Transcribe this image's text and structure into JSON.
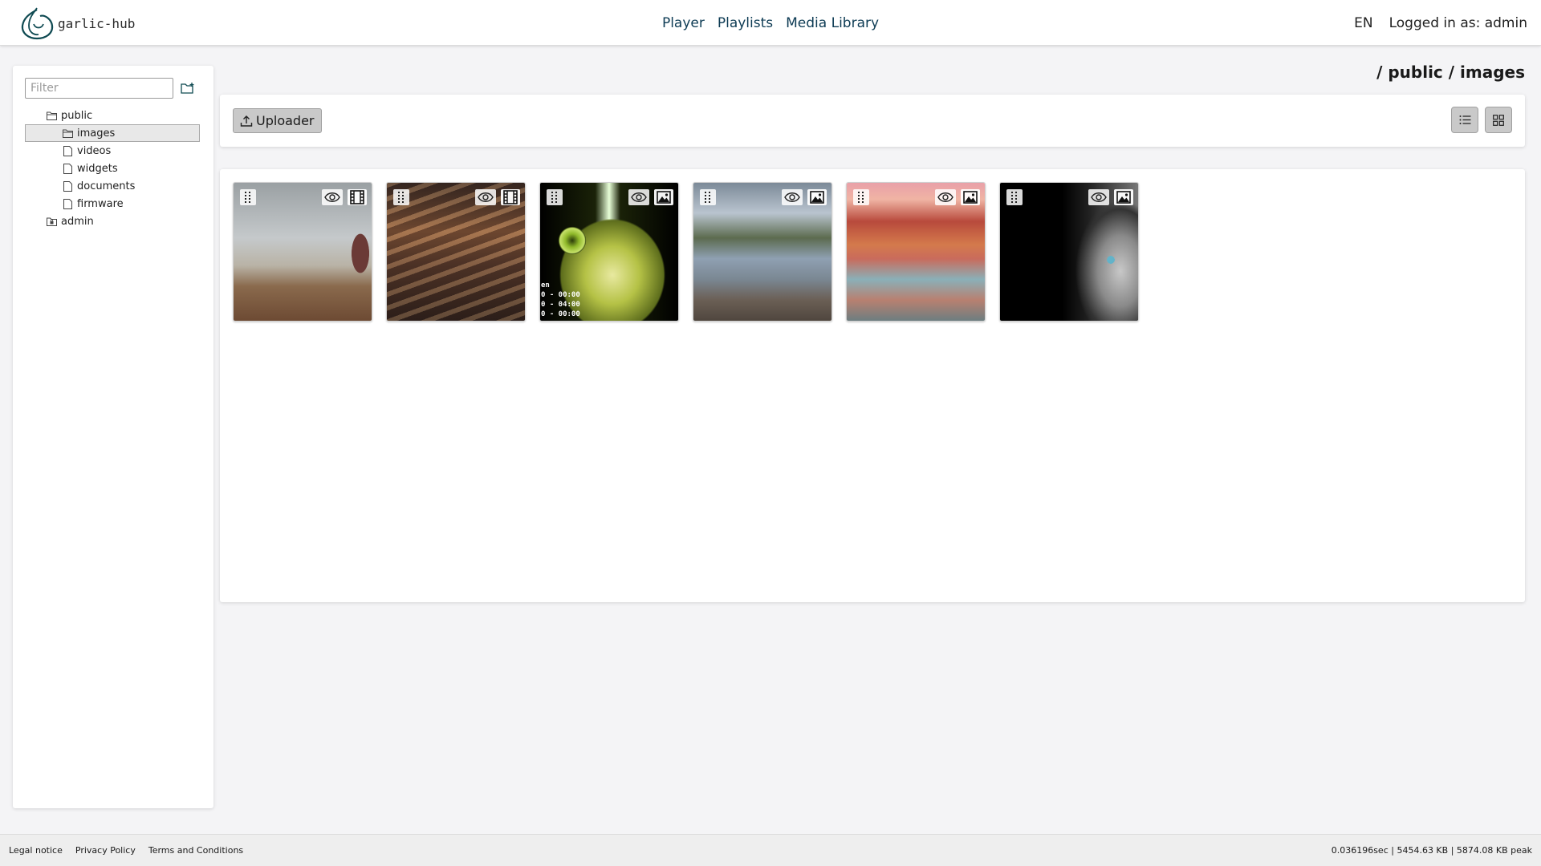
{
  "header": {
    "logo_text": "garlic-hub",
    "nav": [
      "Player",
      "Playlists",
      "Media Library"
    ],
    "language": "EN",
    "login_status": "Logged in as: admin"
  },
  "sidebar": {
    "filter_placeholder": "Filter",
    "tree": [
      {
        "label": "public",
        "icon": "folder-open-icon"
      },
      {
        "label": "images",
        "icon": "folder-open-icon",
        "selected": true
      },
      {
        "label": "videos",
        "icon": "file-icon"
      },
      {
        "label": "widgets",
        "icon": "file-icon"
      },
      {
        "label": "documents",
        "icon": "file-icon"
      },
      {
        "label": "firmware",
        "icon": "file-icon"
      },
      {
        "label": "admin",
        "icon": "folder-lock-icon"
      }
    ]
  },
  "content": {
    "breadcrumb": "/ public / images",
    "uploader_label": "Uploader",
    "media": [
      {
        "type": "video",
        "type_icon": "film-icon"
      },
      {
        "type": "video",
        "type_icon": "film-icon"
      },
      {
        "type": "image",
        "type_icon": "image-icon",
        "overlay_text": [
          "en",
          "0 - 00:00",
          "0 - 04:00",
          "0 - 00:00"
        ]
      },
      {
        "type": "image",
        "type_icon": "image-icon"
      },
      {
        "type": "image",
        "type_icon": "image-icon"
      },
      {
        "type": "image",
        "type_icon": "image-icon"
      }
    ]
  },
  "footer": {
    "links": [
      "Legal notice",
      "Privacy Policy",
      "Terms and Conditions"
    ],
    "stats": "0.036196sec | 5454.63 KB | 5874.08 KB peak"
  },
  "colors": {
    "nav_link": "#0d3b54",
    "background": "#f4f4f6",
    "button_gray": "#c9c9c9"
  }
}
